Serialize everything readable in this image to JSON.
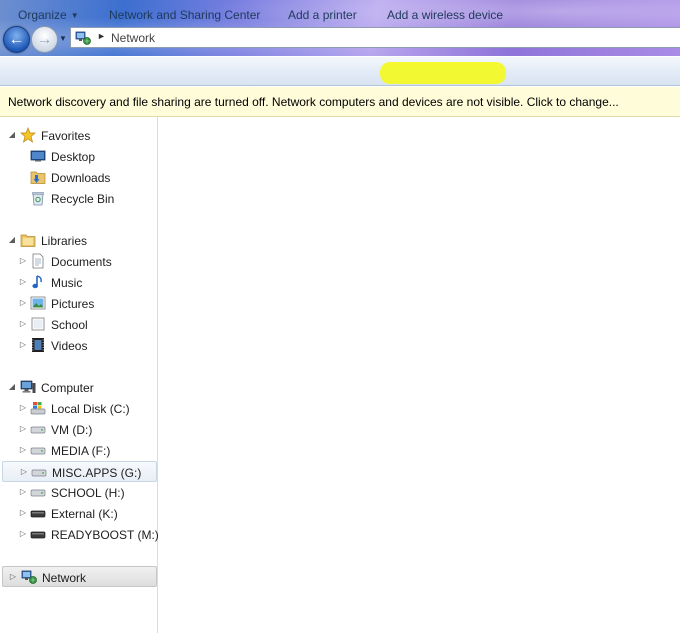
{
  "address": {
    "current": "Network"
  },
  "commands": {
    "organize": "Organize",
    "network_sharing": "Network and Sharing Center",
    "add_printer": "Add a printer",
    "add_wireless": "Add a wireless device"
  },
  "infobar": {
    "message": "Network discovery and file sharing are turned off. Network computers and devices are not visible. Click to change..."
  },
  "nav": {
    "favorites": {
      "label": "Favorites",
      "items": [
        "Desktop",
        "Downloads",
        "Recycle Bin"
      ]
    },
    "libraries": {
      "label": "Libraries",
      "items": [
        "Documents",
        "Music",
        "Pictures",
        "School",
        "Videos"
      ]
    },
    "computer": {
      "label": "Computer",
      "items": [
        "Local Disk (C:)",
        "VM (D:)",
        "MEDIA (F:)",
        "MISC.APPS (G:)",
        "SCHOOL (H:)",
        "External (K:)",
        "READYBOOST (M:)"
      ]
    },
    "network": {
      "label": "Network"
    }
  },
  "colors": {
    "highlight": "#f3f81f",
    "infobar_bg": "#fefcd9",
    "command_text": "#1e395b"
  },
  "icons": {
    "back": "back-arrow-icon",
    "forward": "forward-arrow-icon",
    "network": "network-icon",
    "star": "star-icon",
    "drive": "drive-icon"
  }
}
